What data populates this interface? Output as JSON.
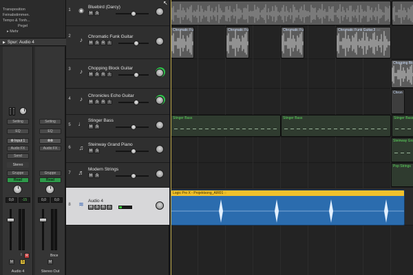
{
  "inspector": {
    "rows": [
      "Transposition",
      "Feinabstimmen.",
      "Tempo & Tonh...",
      "Pegel"
    ],
    "mehr_label": "Mehr",
    "spur_label": "Spur: Audio 4"
  },
  "strips": [
    {
      "name": "Audio 4",
      "setting": "Setting",
      "eq": "EQ",
      "input": "Input 1",
      "audio_fx": "Audio FX",
      "send": "Send",
      "stereo": "Stereo",
      "group": "Gruppe",
      "read": "Read",
      "vol_value": "0,0",
      "peak_value": "-15",
      "mute": "M",
      "solo": "S",
      "in_label": "I",
      "rec_label": "R"
    },
    {
      "name": "Stereo Out",
      "setting": "Setting",
      "eq": "EQ",
      "input": "⦾⦾",
      "audio_fx": "Audio FX",
      "group": "Gruppe",
      "read": "Read",
      "vol_value": "0,0",
      "peak_value": "0,0",
      "mute": "M",
      "bounce": "Bnce"
    }
  ],
  "tracks": [
    {
      "num": "1",
      "name": "Bluebird (Darcy)",
      "icon": "drummer-icon",
      "glyph": "◉",
      "buttons": [
        "M",
        "S"
      ]
    },
    {
      "num": "2",
      "name": "Chromatic Funk Guitar",
      "icon": "guitar-icon",
      "glyph": "♪",
      "buttons": [
        "M",
        "S",
        "R",
        "I"
      ]
    },
    {
      "num": "3",
      "name": "Chopping Block Guitar",
      "icon": "guitar-icon",
      "glyph": "♪",
      "buttons": [
        "M",
        "S",
        "R",
        "I"
      ]
    },
    {
      "num": "4",
      "name": "Chronicles Echo Guitar",
      "icon": "guitar-icon",
      "glyph": "♪",
      "buttons": [
        "M",
        "S",
        "R",
        "I"
      ]
    },
    {
      "num": "5",
      "name": "Stinger Bass",
      "icon": "bass-icon",
      "glyph": "♩",
      "buttons": [
        "M",
        "S"
      ]
    },
    {
      "num": "6",
      "name": "Steinway Grand Piano",
      "icon": "piano-icon",
      "glyph": "♫",
      "buttons": [
        "M",
        "S"
      ]
    },
    {
      "num": "7",
      "name": "Modern Strings",
      "icon": "strings-icon",
      "glyph": "♬",
      "buttons": [
        "M",
        "S"
      ]
    },
    {
      "num": "8",
      "name": "Audio 4",
      "icon": "waveform-icon",
      "glyph": "≋",
      "buttons": [
        "M",
        "S",
        "R",
        "I"
      ]
    }
  ],
  "regions": {
    "chromatic": [
      "Chromatic Fun",
      "Chromatic Funk",
      "Chromatic Funk",
      "Chromatic Funk Guitar.3 ◌◌"
    ],
    "chopping": "Chopping Block",
    "chronicles": "Chron",
    "stinger": [
      "Stinger Bass",
      "Stinger Bass",
      "Stinger Bass"
    ],
    "steinway": "Steinway Grand",
    "strings": "Pop Strings",
    "audio4": "Logic Pro X - Projektsong_AIR01 ◌"
  },
  "colors": {
    "accent_yellow": "#f1c12b",
    "audio_blue": "#2b6cae",
    "midi_green": "#5edc5e",
    "read_green": "#2e9a4a",
    "record_red": "#c43232"
  }
}
